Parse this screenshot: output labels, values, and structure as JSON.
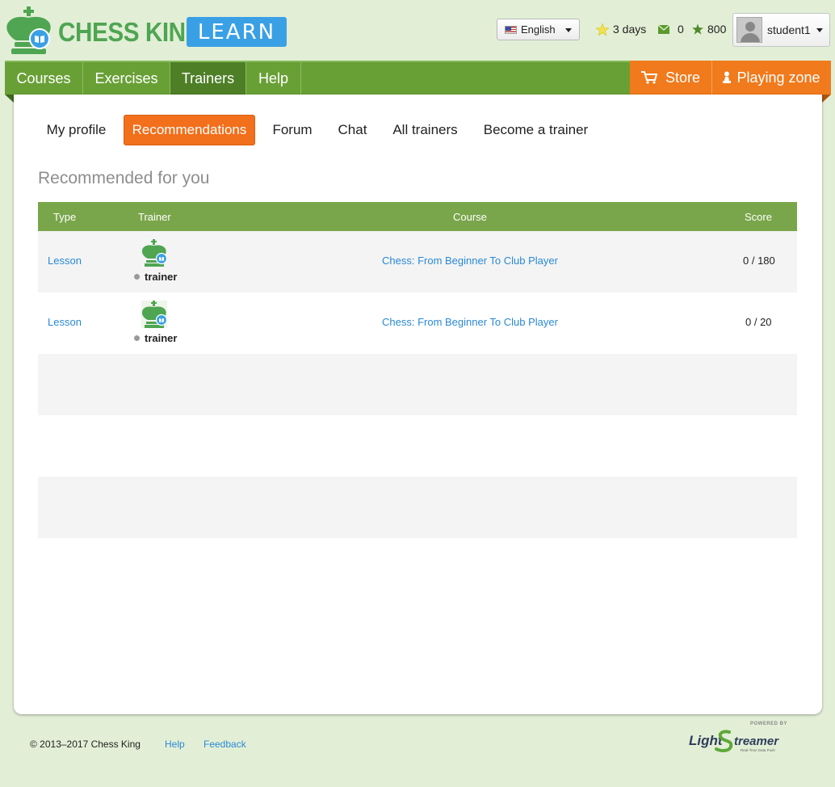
{
  "header": {
    "logo_text": "CHESS KING",
    "logo_badge": "LEARN",
    "language": "English",
    "stats": {
      "days": "3 days",
      "messages": "0",
      "rating": "800"
    },
    "user": {
      "name": "student1"
    }
  },
  "nav": {
    "items": [
      {
        "label": "Courses"
      },
      {
        "label": "Exercises"
      },
      {
        "label": "Trainers"
      },
      {
        "label": "Help"
      }
    ],
    "store": "Store",
    "playing_zone": "Playing zone"
  },
  "subnav": {
    "items": [
      {
        "label": "My profile"
      },
      {
        "label": "Recommendations"
      },
      {
        "label": "Forum"
      },
      {
        "label": "Chat"
      },
      {
        "label": "All trainers"
      },
      {
        "label": "Become a trainer"
      }
    ]
  },
  "section_title": "Recommended for you",
  "table": {
    "headers": {
      "type": "Type",
      "trainer": "Trainer",
      "course": "Course",
      "score": "Score"
    },
    "rows": [
      {
        "type": "Lesson",
        "trainer": "trainer",
        "course": "Chess: From Beginner To Club Player",
        "score": "0 / 180"
      },
      {
        "type": "Lesson",
        "trainer": "trainer",
        "course": "Chess: From Beginner To Club Player",
        "score": "0 / 20"
      }
    ]
  },
  "footer": {
    "copyright": "© 2013–2017 Chess King",
    "help": "Help",
    "feedback": "Feedback",
    "powered_by": "POWERED BY",
    "ls_light": "Light",
    "ls_streamer": "treamer",
    "ls_tagline": "Real-Time Data Push"
  },
  "colors": {
    "nav_green": "#69a036",
    "nav_active": "#4e7f27",
    "orange": "#f07a1c",
    "link_blue": "#2a89d6",
    "table_header": "#7aa64b"
  },
  "icons": [
    "chess-king-logo-icon",
    "us-flag-icon",
    "star-icon",
    "mail-icon",
    "rating-star-icon",
    "cart-icon",
    "pawn-icon"
  ]
}
